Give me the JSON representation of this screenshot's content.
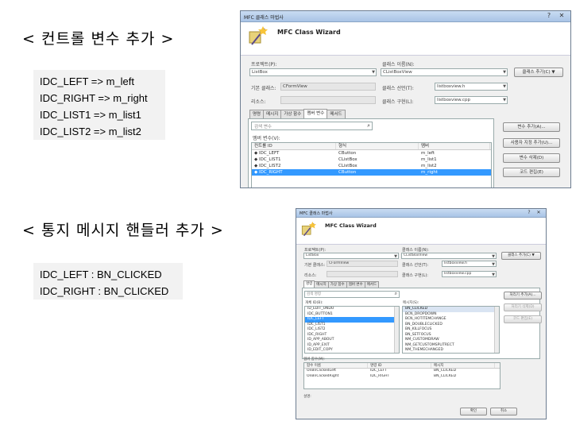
{
  "section1": {
    "heading": "< 컨트롤 변수 추가 >",
    "lines": [
      "IDC_LEFT => m_left",
      "IDC_RIGHT => m_right",
      "IDC_LIST1 => m_list1",
      "IDC_LIST2 => m_list2"
    ]
  },
  "section2": {
    "heading": "< 통지 메시지 핸들러 추가 >",
    "lines": [
      "IDC_LEFT : BN_CLICKED",
      "IDC_RIGHT : BN_CLICKED"
    ]
  },
  "wizard1": {
    "window_title": "MFC 클래스 마법사",
    "header_title": "MFC Class Wizard",
    "project_label": "프로젝트(P):",
    "project_value": "ListBox",
    "class_name_label": "클래스 이름(N):",
    "class_name_value": "CListBoxView",
    "add_class_button": "클래스 추가(C)",
    "base_class_label": "기본 클래스:",
    "base_class_value": "CFormView",
    "declaration_label": "클래스 선언(T):",
    "declaration_value": "listboxview.h",
    "resource_label": "리소스:",
    "implementation_label": "클래스 구현(L):",
    "implementation_value": "listboxview.cpp",
    "tabs": [
      "명령",
      "메시지",
      "가상 함수",
      "멤버 변수",
      "메서드"
    ],
    "active_tab": 3,
    "search_placeholder": "검색 변수",
    "list_label": "멤버 변수(V):",
    "columns": [
      "컨트롤 ID",
      "형식",
      "멤버"
    ],
    "rows": [
      [
        "IDC_LEFT",
        "CButton",
        "m_left"
      ],
      [
        "IDC_LIST1",
        "CListBox",
        "m_list1"
      ],
      [
        "IDC_LIST2",
        "CListBox",
        "m_list2"
      ],
      [
        "IDC_RIGHT",
        "CButton",
        "m_right"
      ]
    ],
    "selected_row": 3,
    "side_buttons": [
      "변수 추가(A)...",
      "사용자 지정 추가(U)...",
      "변수 삭제(D)",
      "코드 편집(E)"
    ]
  },
  "wizard2": {
    "window_title": "MFC 클래스 마법사",
    "header_title": "MFC Class Wizard",
    "project_label": "프로젝트(P):",
    "project_value": "ListBox",
    "class_name_label": "클래스 이름(N):",
    "class_name_value": "CListBoxView",
    "add_class_button": "클래스 추가(C)",
    "base_class_label": "기본 클래스:",
    "base_class_value": "CFormView",
    "declaration_label": "클래스 선언(T):",
    "declaration_value": "listboxview.h",
    "resource_label": "리소스:",
    "implementation_label": "클래스 구현(L):",
    "implementation_value": "listboxview.cpp",
    "tabs": [
      "명령",
      "메시지",
      "가상 함수",
      "멤버 변수",
      "메서드"
    ],
    "active_tab": 0,
    "search_placeholder": "검색 명령",
    "object_ids_label": "개체 ID(B):",
    "object_ids": [
      "ID_EDIT_UNDO",
      "IDC_BUTTON1",
      "IDC_LEFT",
      "IDC_LIST1",
      "IDC_LIST2",
      "IDC_RIGHT",
      "ID_APP_ABOUT",
      "ID_APP_EXIT",
      "ID_EDIT_COPY"
    ],
    "selected_object": 2,
    "messages_label": "메시지(S):",
    "messages": [
      "BN_CLICKED",
      "BCN_DROPDOWN",
      "BCN_HOTITEMCHANGE",
      "BN_DOUBLECLICKED",
      "BN_KILLFOCUS",
      "BN_SETFOCUS",
      "NM_CUSTOMDRAW",
      "NM_GETCUSTOMSPLITRECT",
      "NM_THEMECHANGED"
    ],
    "selected_message": 0,
    "side_buttons": [
      "처리기 추가(A)...",
      "처리기 삭제(D)",
      "코드 편집(E)"
    ],
    "handlers_label": "멤버 함수(M):",
    "handler_columns": [
      "함수 이름",
      "명령 ID",
      "메시지"
    ],
    "handlers": [
      [
        "OnBnClickedLeft",
        "IDC_LEFT",
        "BN_CLICKED"
      ],
      [
        "OnBnClickedRight",
        "IDC_RIGHT",
        "BN_CLICKED"
      ]
    ],
    "description_label": "설명:",
    "ok_button": "확인",
    "cancel_button": "취소"
  }
}
